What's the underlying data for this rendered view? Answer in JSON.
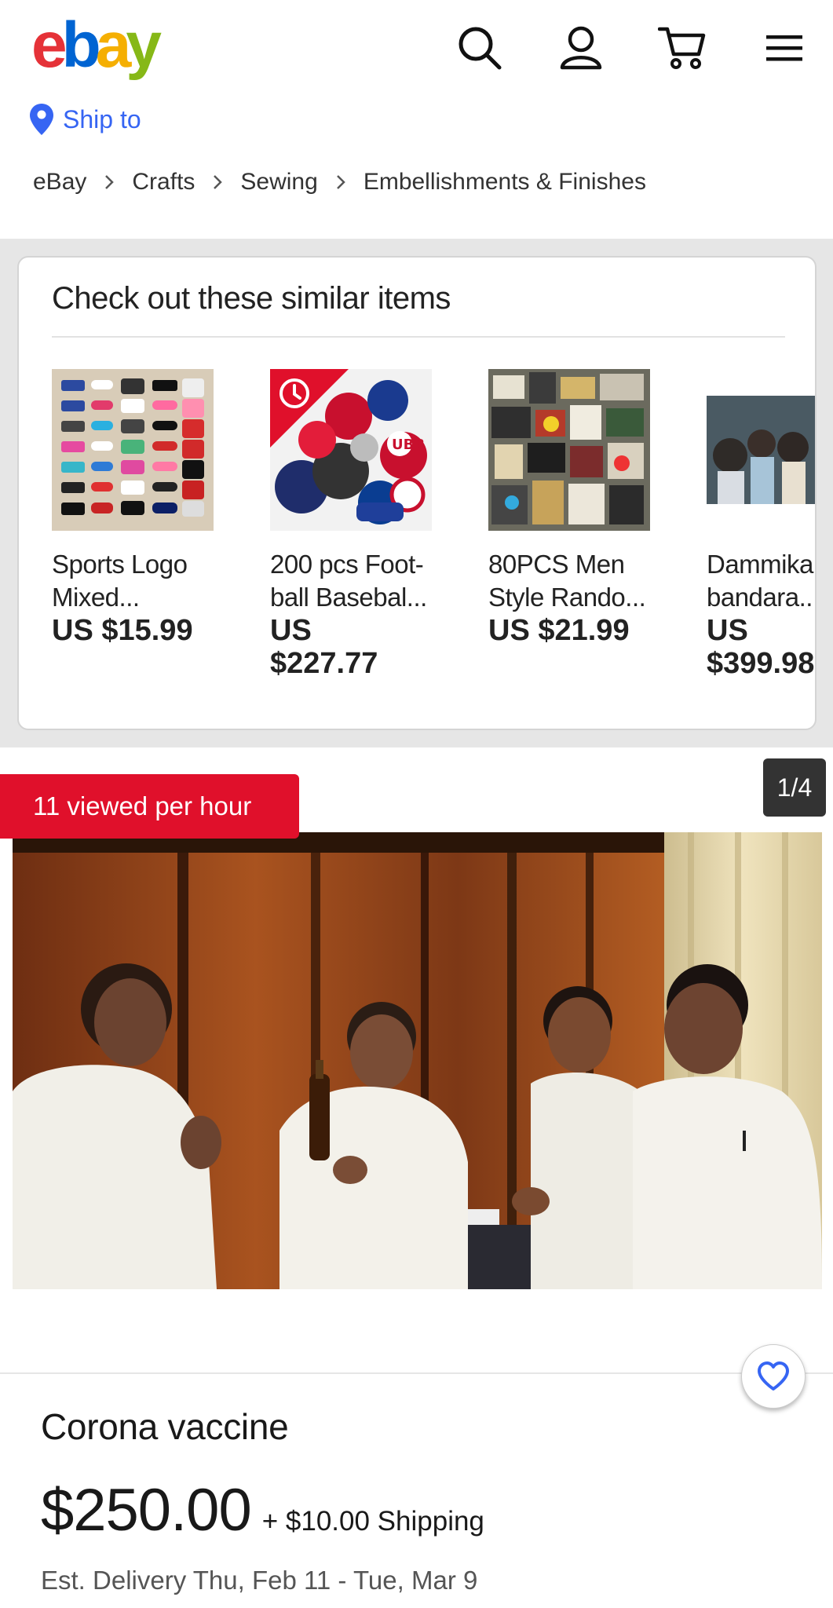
{
  "header": {
    "logo_letters": [
      "e",
      "b",
      "a",
      "y"
    ],
    "logo_colors": [
      "#e53238",
      "#0064d2",
      "#f5af02",
      "#86b817"
    ],
    "icons": [
      "search-icon",
      "account-icon",
      "cart-icon",
      "menu-icon"
    ],
    "ship_to": "Ship to"
  },
  "breadcrumb": {
    "items": [
      "eBay",
      "Crafts",
      "Sewing",
      "Embellishments & Finishes"
    ]
  },
  "similar": {
    "title": "Check out these similar items",
    "items": [
      {
        "name_line1": "Sports Logo",
        "name_line2": "Mixed...",
        "price_line1": "US $15.99",
        "price_line2": ""
      },
      {
        "name_line1": "200 pcs Foot-",
        "name_line2": "ball Basebal...",
        "price_line1": "US",
        "price_line2": "$227.77"
      },
      {
        "name_line1": "80PCS Men",
        "name_line2": "Style Rando...",
        "price_line1": "US $21.99",
        "price_line2": ""
      },
      {
        "name_line1": "Dammika",
        "name_line2": "bandara...",
        "price_line1": "US",
        "price_line2": "$399.98"
      }
    ]
  },
  "listing": {
    "viewed_badge": "11 viewed per hour",
    "image_counter": "1/4",
    "title": "Corona vaccine",
    "price": "$250.00",
    "shipping": "+ $10.00 Shipping",
    "delivery": "Est. Delivery Thu, Feb 11 - Tue, Mar 9"
  },
  "colors": {
    "accent_blue": "#3665f3",
    "badge_red": "#e0102b"
  }
}
